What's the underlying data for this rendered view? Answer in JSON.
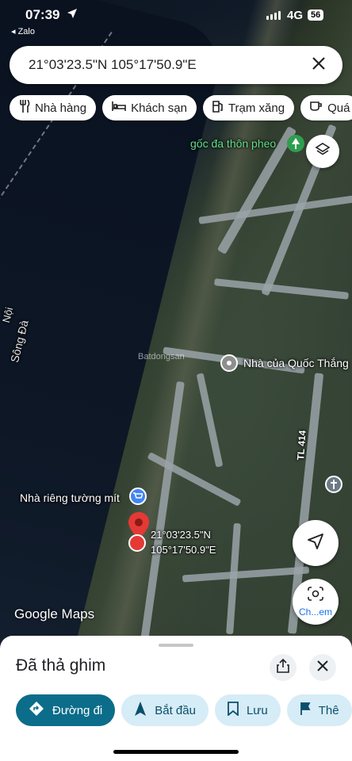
{
  "status_bar": {
    "time": "07:39",
    "back_app": "◂ Zalo",
    "network": "4G",
    "battery": "56"
  },
  "search": {
    "value": "21°03'23.5\"N 105°17'50.9\"E"
  },
  "chips": [
    {
      "label": "Nhà hàng",
      "icon": "fork-knife-icon"
    },
    {
      "label": "Khách sạn",
      "icon": "bed-icon"
    },
    {
      "label": "Trạm xăng",
      "icon": "gas-pump-icon"
    },
    {
      "label": "Quá",
      "icon": "cafe-cup-icon"
    }
  ],
  "map": {
    "labels": {
      "goc_da": "gốc đa thôn pheo",
      "song_da": "Sông Đà",
      "noi": "Nội",
      "nha_quoc_thang": "Nhà của Quốc Thắng",
      "tl414": "TL 414",
      "nha_rieng": "Nhà riêng tường mít",
      "pin_line1": "21°03'23.5\"N",
      "pin_line2": "105°17'50.9\"E",
      "watermark": "Batdongsan",
      "google": "Google Maps"
    },
    "screenshot_button_label": "Ch...em",
    "colors": {
      "pin": "#e53935",
      "green_label": "#5fe08a",
      "shop_icon": "#4285f4"
    }
  },
  "sheet": {
    "title": "Đã thả ghim",
    "actions": [
      {
        "label": "Đường đi",
        "icon": "directions-icon",
        "primary": true
      },
      {
        "label": "Bắt đầu",
        "icon": "navigation-arrow-icon",
        "primary": false
      },
      {
        "label": "Lưu",
        "icon": "bookmark-icon",
        "primary": false
      },
      {
        "label": "Thê",
        "icon": "flag-icon",
        "primary": false
      }
    ]
  }
}
